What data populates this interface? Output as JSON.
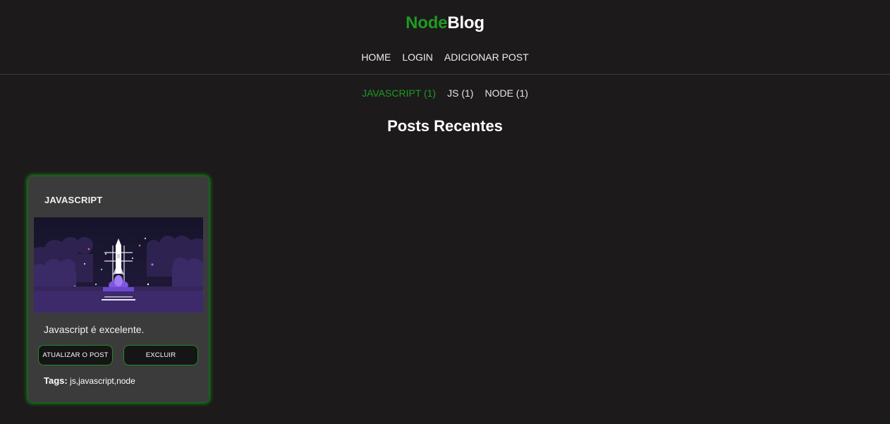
{
  "brand": {
    "part1": "Node",
    "part2": "Blog",
    "accent_color": "#1f9b21"
  },
  "nav": {
    "items": [
      {
        "label": "HOME"
      },
      {
        "label": "LOGIN"
      },
      {
        "label": "ADICIONAR POST"
      }
    ]
  },
  "categories": {
    "items": [
      {
        "label": "JAVASCRIPT (1)",
        "active": true
      },
      {
        "label": "JS (1)",
        "active": false
      },
      {
        "label": "NODE (1)",
        "active": false
      }
    ]
  },
  "section_title": "Posts Recentes",
  "posts": [
    {
      "title": "JAVASCRIPT",
      "image_icon": "rocket-launch-illustration",
      "excerpt": "Javascript é excelente.",
      "update_label": "ATUALIZAR O POST",
      "delete_label": "EXCLUIR",
      "tags_label": "Tags:",
      "tags_value": "js,javascript,node"
    }
  ]
}
